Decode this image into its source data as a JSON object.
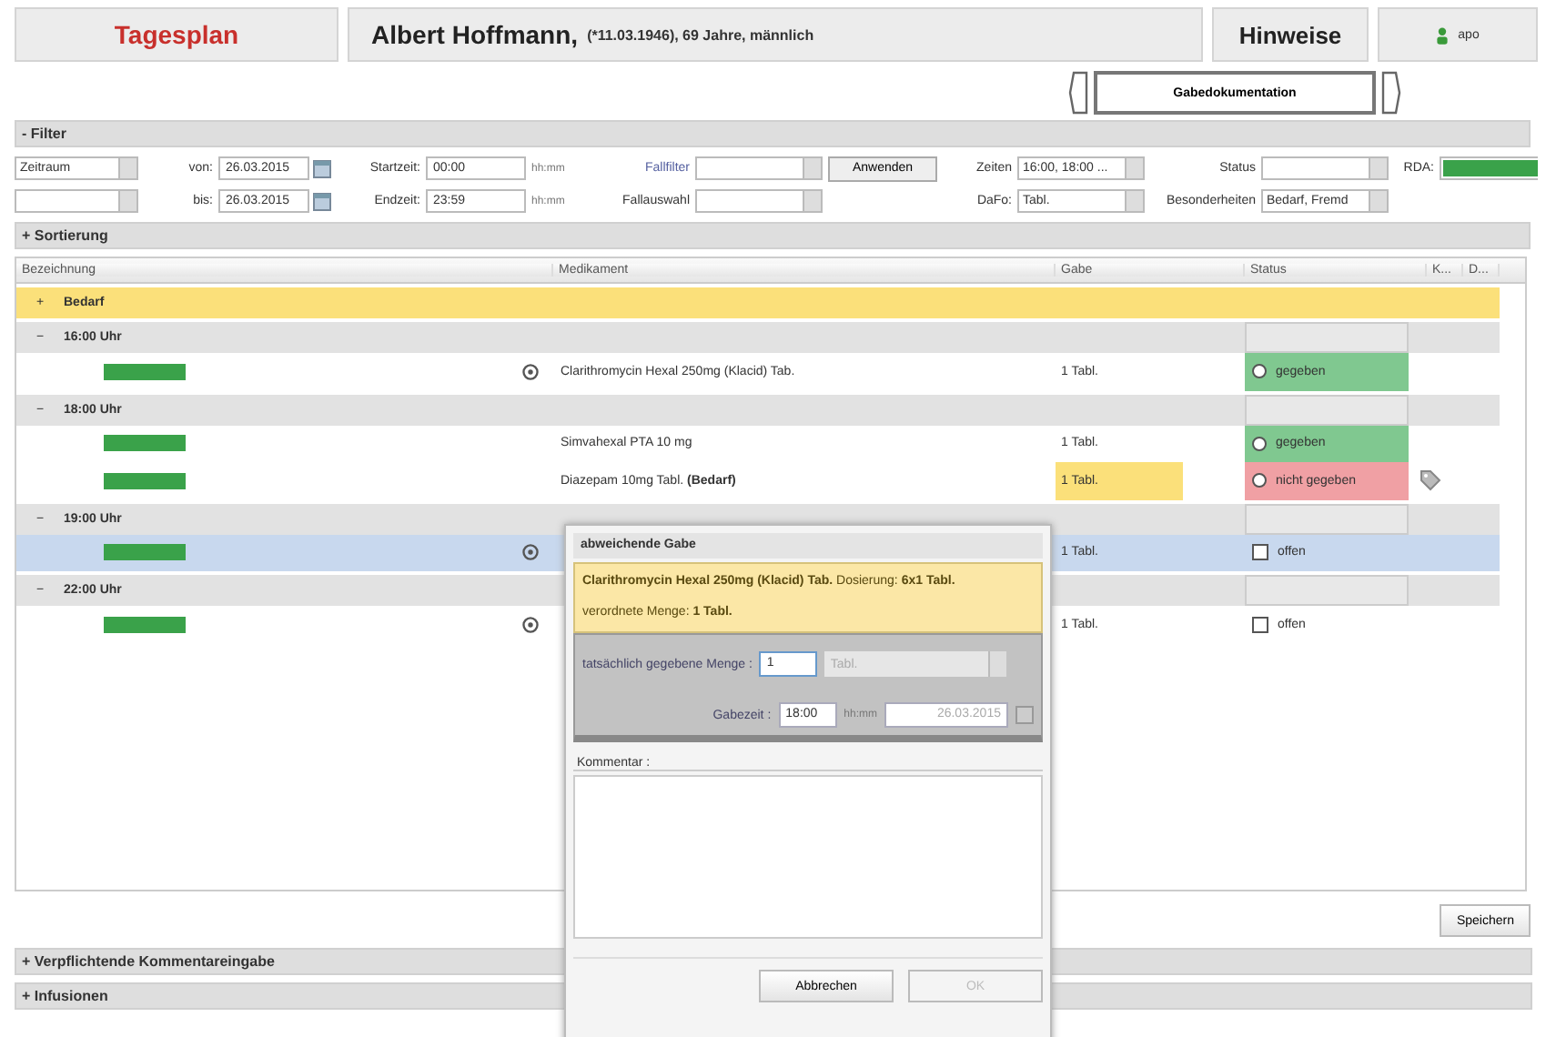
{
  "header": {
    "title": "Tagesplan",
    "patient_name": "Albert Hoffmann,",
    "patient_details": "(*11.03.1946), 69 Jahre, männlich",
    "notes_button": "Hinweise",
    "user": "apo"
  },
  "nav": {
    "label": "Gabedokumentation"
  },
  "filter": {
    "title": "- Filter",
    "rows": [
      [
        {
          "kind": "select",
          "value": "Zeitraum"
        },
        {
          "kind": "label",
          "text": "von:"
        },
        {
          "kind": "date",
          "value": "26.03.2015"
        },
        {
          "kind": "label",
          "text": "Startzeit:"
        },
        {
          "kind": "text",
          "value": "00:00"
        },
        {
          "kind": "hint",
          "text": "hh:mm"
        },
        {
          "kind": "link",
          "text": "Fallfilter"
        },
        {
          "kind": "select"
        },
        {
          "kind": "button",
          "text": "Anwenden"
        },
        {
          "kind": "label",
          "text": "Zeiten"
        },
        {
          "kind": "select",
          "value": "16:00, 18:00 ..."
        },
        {
          "kind": "label",
          "text": "Status"
        },
        {
          "kind": "select"
        },
        {
          "kind": "label",
          "text": "RDA:"
        },
        {
          "kind": "redacted_select"
        }
      ],
      [
        {
          "kind": "select"
        },
        {
          "kind": "label",
          "text": "bis:"
        },
        {
          "kind": "date",
          "value": "26.03.2015"
        },
        {
          "kind": "label",
          "text": "Endzeit:"
        },
        {
          "kind": "text",
          "value": "23:59"
        },
        {
          "kind": "hint",
          "text": "hh:mm"
        },
        {
          "kind": "label",
          "text": "Fallauswahl"
        },
        {
          "kind": "select"
        },
        {
          "kind": "spacer"
        },
        {
          "kind": "label",
          "text": "DaFo:"
        },
        {
          "kind": "select",
          "value": "Tabl."
        },
        {
          "kind": "label",
          "text": "Besonderheiten"
        },
        {
          "kind": "select",
          "value": "Bedarf, Fremd"
        }
      ]
    ]
  },
  "sorting": {
    "title": "+ Sortierung"
  },
  "table": {
    "columns": [
      "Bezeichnung",
      "Medikament",
      "Gabe",
      "Status",
      "K...",
      "D..."
    ],
    "rows": [
      {
        "kind": "group",
        "toggle": "+",
        "label": "Bedarf",
        "highlight": true,
        "status_select": false
      },
      {
        "kind": "group",
        "toggle": "−",
        "label": "16:00 Uhr",
        "highlight": false,
        "status_select": true
      },
      {
        "kind": "item",
        "info": true,
        "medication": "Clarithromycin Hexal 250mg (Klacid) Tab.",
        "dose": "1 Tabl.",
        "dose_highlight": false,
        "color": "#80c890",
        "status_text": "gegeben",
        "selected": false,
        "tagged": false
      },
      {
        "kind": "group",
        "toggle": "−",
        "label": "18:00 Uhr",
        "highlight": false,
        "status_select": true
      },
      {
        "kind": "item",
        "info": false,
        "medication": "Simvahexal PTA 10 mg",
        "dose": "1 Tabl.",
        "dose_highlight": false,
        "color": "#80c890",
        "status_text": "gegeben",
        "selected": false,
        "tagged": false
      },
      {
        "kind": "item",
        "info": false,
        "medication": "Diazepam 10mg Tabl. **(Bedarf)**",
        "dose": "1 Tabl.",
        "dose_highlight": true,
        "color": "#f0a0a4",
        "status_text": "nicht gegeben",
        "selected": false,
        "tagged": true
      },
      {
        "kind": "group",
        "toggle": "−",
        "label": "19:00 Uhr",
        "highlight": false,
        "status_select": true
      },
      {
        "kind": "item",
        "info": true,
        "dose": "1 Tabl.",
        "dose_highlight": false,
        "status_text": "offen",
        "selected": true,
        "tagged": false
      },
      {
        "kind": "group",
        "toggle": "−",
        "label": "22:00 Uhr",
        "highlight": false,
        "status_select": true
      },
      {
        "kind": "item",
        "info": true,
        "dose": "1 Tabl.",
        "dose_highlight": false,
        "status_text": "offen",
        "selected": false,
        "tagged": false
      }
    ]
  },
  "save_button": "Speichern",
  "sections": [
    {
      "title": "+ Verpflichtende Kommentareingabe"
    },
    {
      "title": "+ Infusionen"
    }
  ],
  "dialog": {
    "title": "abweichende Gabe",
    "info_line": "**Clarithromycin Hexal 250mg (Klacid) Tab.** Dosierung: **6x1 Tabl.**",
    "prescribed": "verordnete Menge: **1 Tabl.**",
    "quantity_label": "tatsächlich gegebene Menge :",
    "quantity": "1",
    "unit": "Tabl.",
    "time_label": "Gabezeit :",
    "time": "18:00",
    "time_hint": "hh:mm",
    "date": "26.03.2015",
    "comment_label": "Kommentar :",
    "buttons": [
      {
        "label": "Abbrechen",
        "disabled": false
      },
      {
        "label": "OK",
        "disabled": true
      }
    ]
  }
}
